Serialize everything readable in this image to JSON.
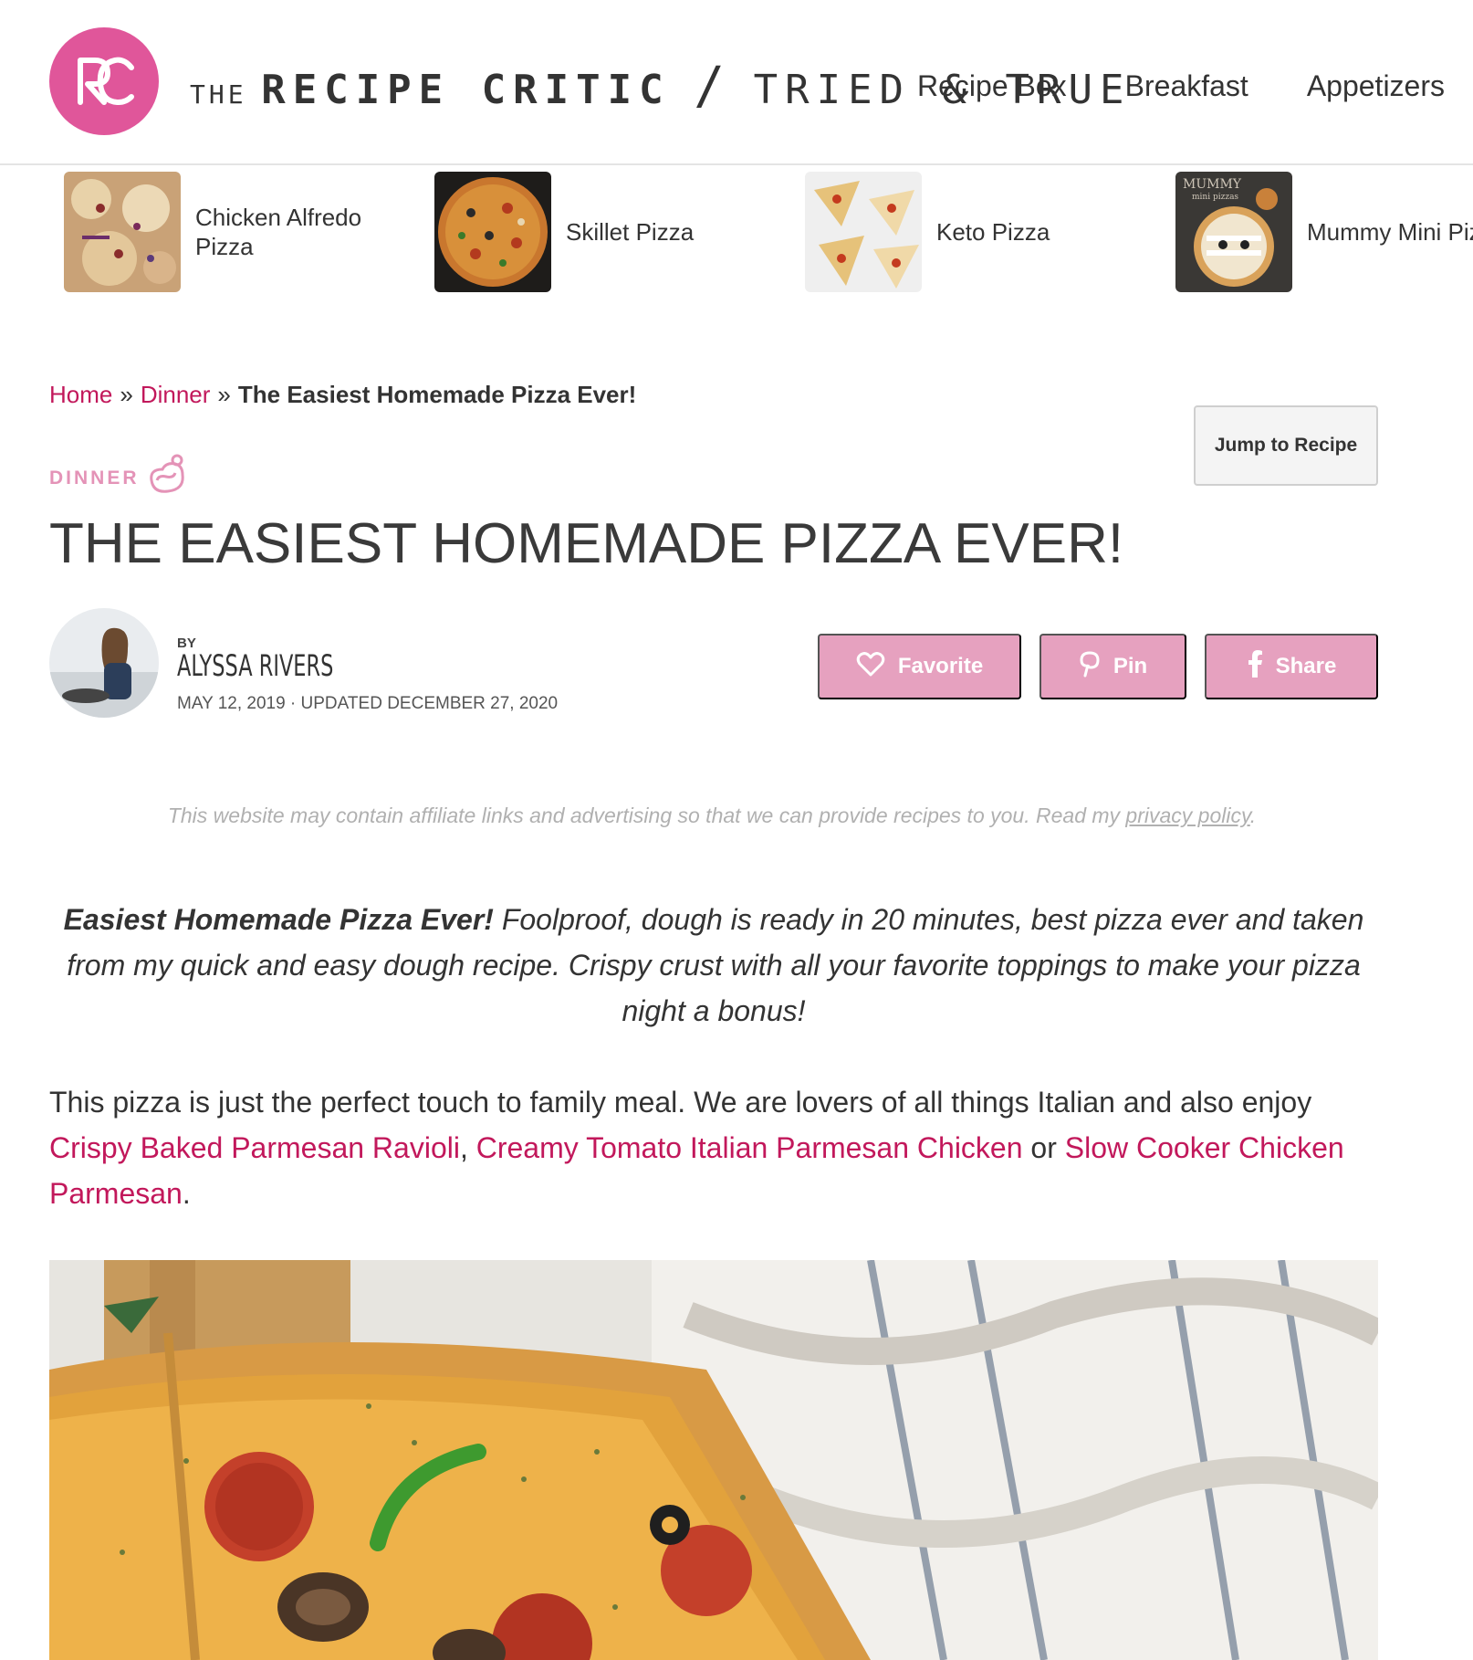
{
  "header": {
    "logo_the": "THE",
    "logo_name": "RECIPE CRITIC",
    "logo_slash": "/",
    "logo_tagline": "TRIED & TRUE",
    "nav": [
      "Recipe Box",
      "Breakfast",
      "Appetizers"
    ]
  },
  "related": [
    {
      "label_line1": "Chicken Alfredo",
      "label_line2": "Pizza"
    },
    {
      "label_line1": "Skillet Pizza",
      "label_line2": ""
    },
    {
      "label_line1": "Keto Pizza",
      "label_line2": ""
    },
    {
      "label_line1": "Mummy Mini Pizzas",
      "label_line2": "",
      "thumb_text_1": "MUMMY",
      "thumb_text_2": "mini pizzas"
    }
  ],
  "breadcrumb": {
    "home": "Home",
    "sep": "»",
    "category": "Dinner",
    "current": "The Easiest Homemade Pizza Ever!"
  },
  "jump_button": "Jump to Recipe",
  "category_label": "DINNER",
  "title": "THE EASIEST HOMEMADE PIZZA EVER!",
  "author": {
    "by": "BY",
    "name": "ALYSSA RIVERS",
    "dates": "MAY 12, 2019 · UPDATED DECEMBER 27, 2020"
  },
  "actions": {
    "favorite": "Favorite",
    "pin": "Pin",
    "share": "Share"
  },
  "disclaimer": {
    "text": "This website may contain affiliate links and advertising so that we can provide recipes to you. Read my ",
    "link": "privacy policy",
    "end": "."
  },
  "intro": {
    "bold": "Easiest Homemade Pizza Ever!",
    "rest": " Foolproof, dough is ready in 20 minutes, best pizza ever and taken from my quick and easy dough recipe. Crispy crust with all your favorite toppings to make your pizza night a bonus!"
  },
  "paragraph": {
    "text": "This pizza is just the perfect touch to family meal. We are lovers of all things Italian and also enjoy ",
    "link1": "Crispy Baked Parmesan Ravioli",
    "comma": ", ",
    "link2": "Creamy Tomato Italian Parmesan Chicken",
    "or": " or ",
    "link3": "Slow Cooker Chicken Parmesan",
    "end": "."
  },
  "colors": {
    "brand_pink": "#e0569a",
    "link": "#c2185b",
    "button_pink": "#e6a1bf"
  },
  "icons": [
    "rc-logo-icon",
    "pizza-category-icon",
    "heart-icon",
    "pinterest-icon",
    "facebook-icon"
  ]
}
